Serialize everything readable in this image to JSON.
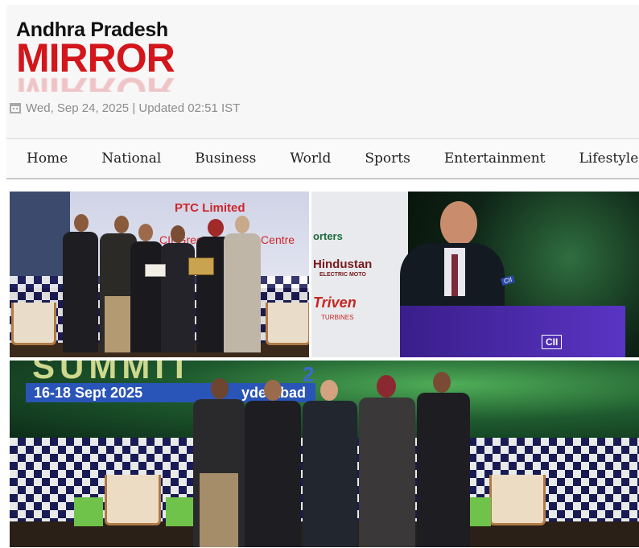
{
  "site": {
    "name_top": "Andhra Pradesh",
    "name_main": "MIRROR",
    "brand_color": "#d3161b"
  },
  "dateline": {
    "icon": "calendar-icon",
    "text": "Wed, Sep 24, 2025 | Updated 02:51 IST"
  },
  "nav": {
    "items": [
      {
        "label": "Home"
      },
      {
        "label": "National"
      },
      {
        "label": "Business"
      },
      {
        "label": "World"
      },
      {
        "label": "Sports"
      },
      {
        "label": "Entertainment"
      },
      {
        "label": "Lifestyle"
      }
    ]
  },
  "photos": {
    "award": {
      "signage_title": "PTC Limited",
      "signage_subtitle": "CII-Green Business Centre"
    },
    "speaker": {
      "sponsors": [
        "orters",
        "Hindustan",
        "ELECTRIC MOTO",
        "Triven",
        "TURBINES"
      ],
      "podium_logo": "CII",
      "mic_badge": "CII"
    },
    "group": {
      "banner_word": "SUMMIT",
      "banner_dates": "16-18 Sept 2025",
      "banner_city": "yderabad",
      "banner_fragment": "2"
    }
  }
}
